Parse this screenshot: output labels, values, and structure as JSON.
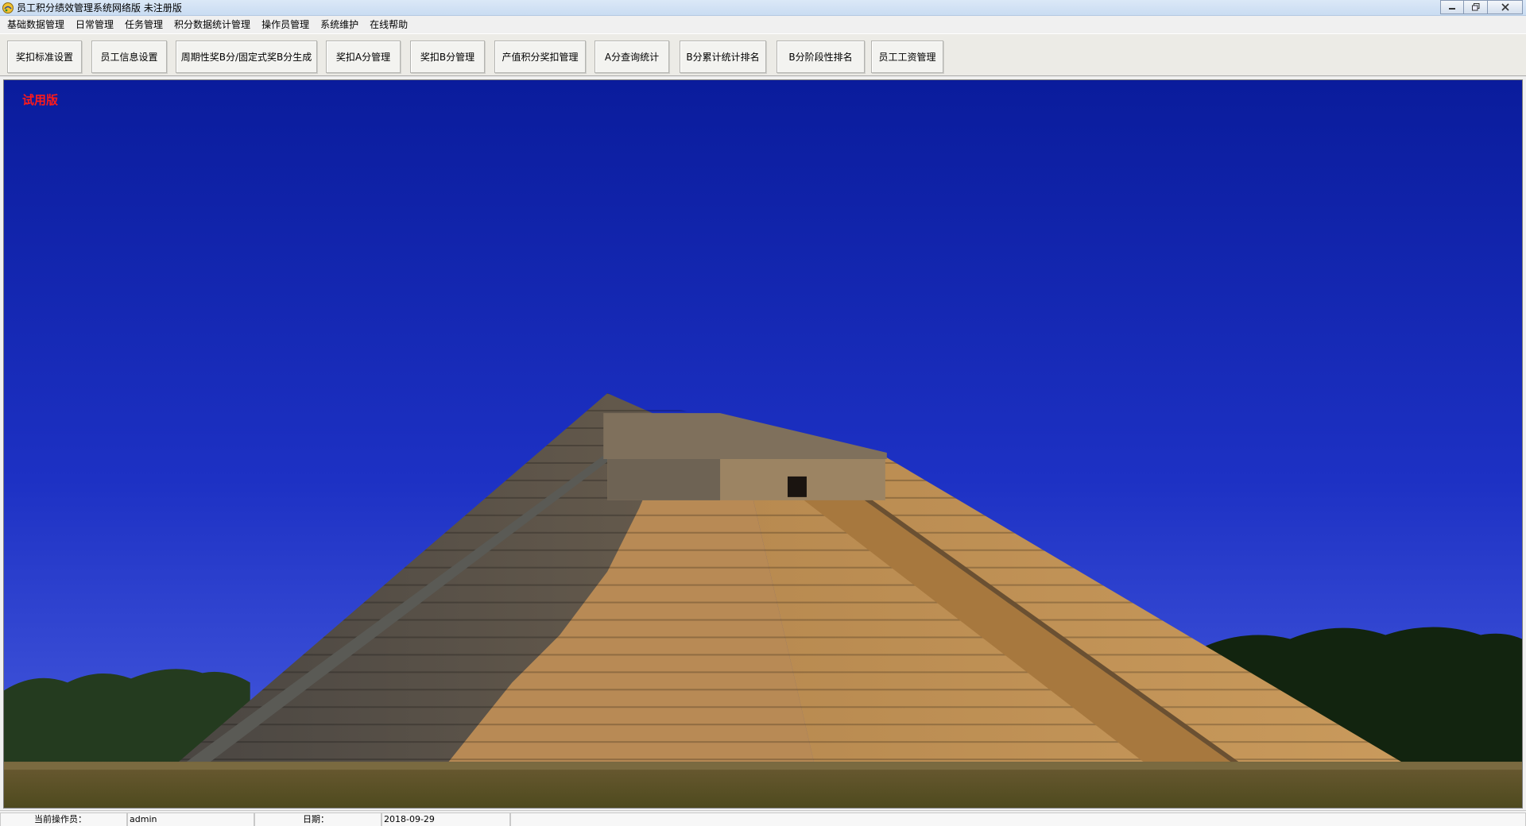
{
  "window": {
    "title": "员工积分绩效管理系统网络版 未注册版",
    "icon": "app-logo-icon",
    "controls": {
      "minimize": "minimize-icon",
      "restore": "restore-icon",
      "close": "close-icon"
    }
  },
  "menu": {
    "items": [
      {
        "label": "基础数据管理"
      },
      {
        "label": "日常管理"
      },
      {
        "label": "任务管理"
      },
      {
        "label": "积分数据统计管理"
      },
      {
        "label": "操作员管理"
      },
      {
        "label": "系统维护"
      },
      {
        "label": "在线帮助"
      }
    ]
  },
  "toolbar": {
    "buttons": [
      {
        "label": "奖扣标准设置"
      },
      {
        "label": "员工信息设置"
      },
      {
        "label": "周期性奖B分/固定式奖B分生成"
      },
      {
        "label": "奖扣A分管理"
      },
      {
        "label": "奖扣B分管理"
      },
      {
        "label": "产值积分奖扣管理"
      },
      {
        "label": "A分查询统计"
      },
      {
        "label": "B分累计统计排名"
      },
      {
        "label": "B分阶段性排名"
      },
      {
        "label": "员工工资管理"
      }
    ]
  },
  "main": {
    "trial_label": "试用版",
    "background_image": "pyramid-photo",
    "colors": {
      "sky_top": "#0b1ea0",
      "sky_bottom": "#3a4fd8",
      "trial_text": "#ff1a1a"
    }
  },
  "status": {
    "operator_label": "当前操作员：",
    "operator_value": "admin",
    "date_label": "日期：",
    "date_value": "2018-09-29"
  }
}
